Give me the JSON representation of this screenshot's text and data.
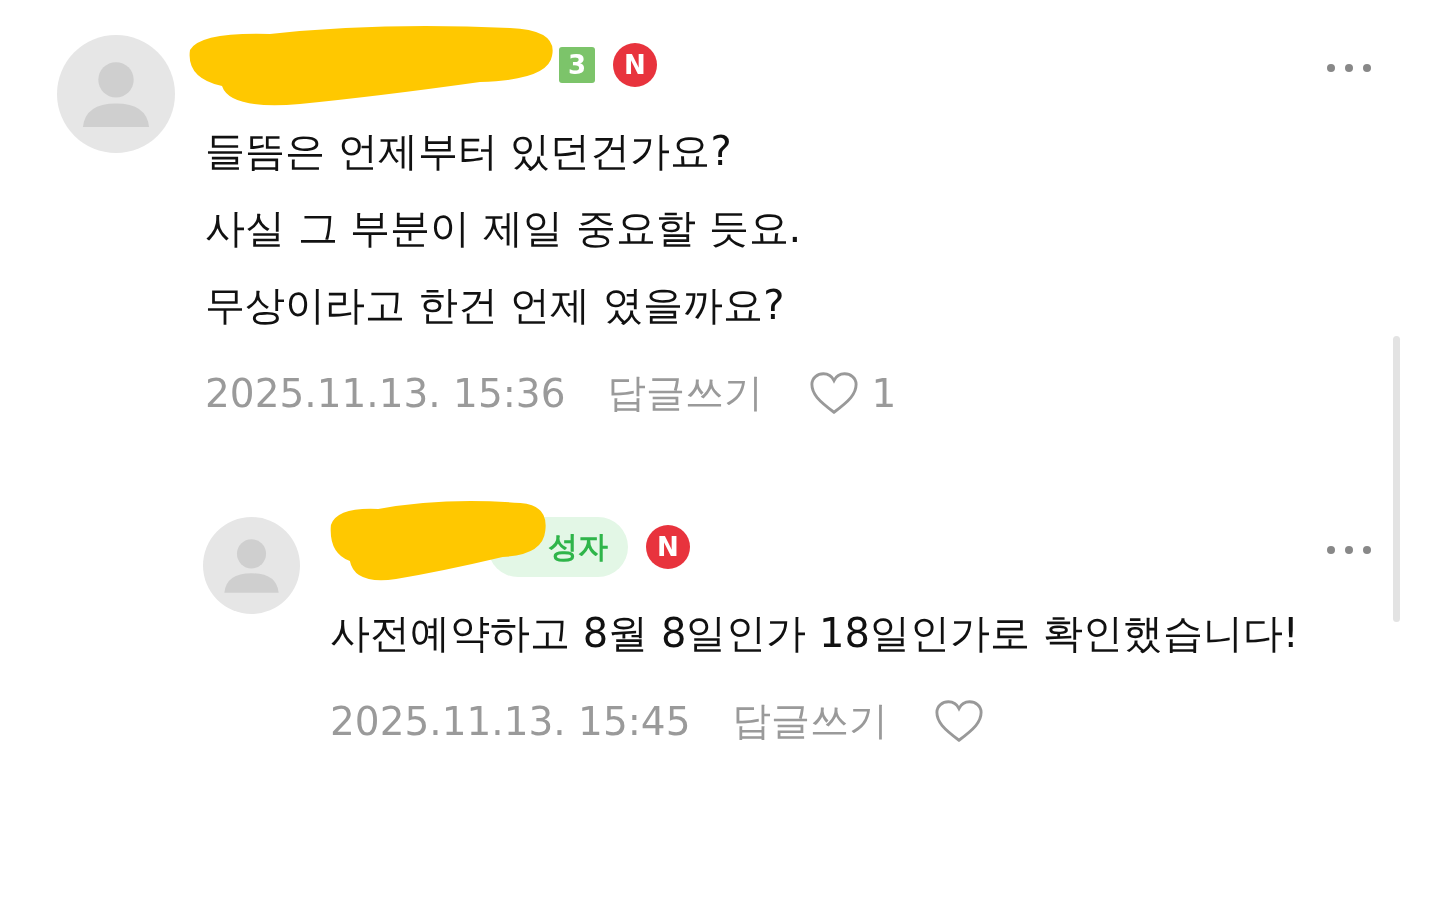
{
  "comments": [
    {
      "badges": [
        {
          "kind": "level",
          "text": "3"
        },
        {
          "kind": "new",
          "text": "N"
        }
      ],
      "body": [
        "들뜸은 언제부터 있던건가요?",
        "사실 그 부분이 제일 중요할 듯요.",
        "무상이라고 한건 언제 였을까요?"
      ],
      "date": "2025.11.13. 15:36",
      "reply_link": "답글쓰기",
      "like_count": "1",
      "replies": [
        {
          "badges": [
            {
              "kind": "author",
              "text": "성자"
            },
            {
              "kind": "new",
              "text": "N"
            }
          ],
          "body": [
            "사전예약하고 8월 8일인가 18일인가로 확인했습니다!"
          ],
          "date": "2025.11.13. 15:45",
          "reply_link": "답글쓰기"
        }
      ]
    }
  ]
}
